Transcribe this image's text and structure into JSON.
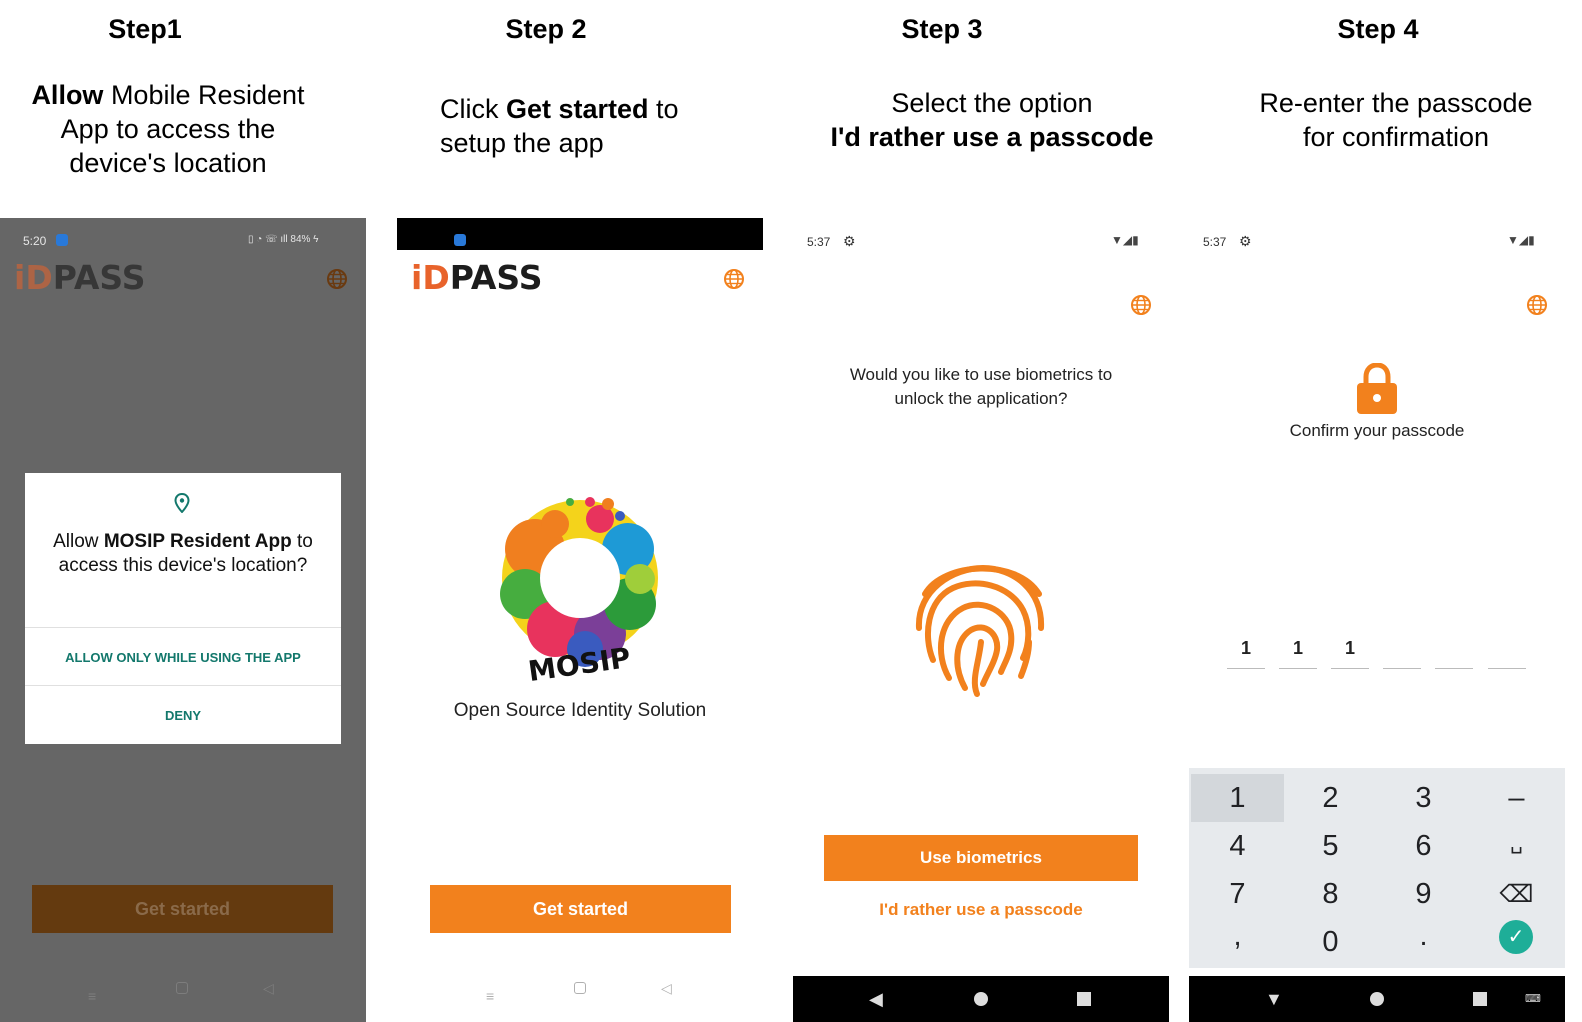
{
  "steps": [
    {
      "title": "Step1",
      "desc_bold": "Allow",
      "desc_rest": " Mobile Resident App to access the device's location"
    },
    {
      "title": "Step 2",
      "desc_pre": "Click ",
      "desc_bold": "Get started",
      "desc_post": " to setup the app"
    },
    {
      "title": "Step 3",
      "desc_line1": "Select the option",
      "desc_bold": "I'd rather use a passcode"
    },
    {
      "title": "Step 4",
      "desc_line1": "Re-enter the passcode",
      "desc_line2": "for confirmation"
    }
  ],
  "logo": {
    "i": "i",
    "d": "D",
    "rest": "PASS"
  },
  "screen1": {
    "time": "5:20",
    "battery": "84%",
    "dialog": {
      "prefix": "Allow ",
      "app_name": "MOSIP Resident App",
      "suffix": " to access this device's location?",
      "allow": "ALLOW ONLY WHILE USING THE APP",
      "deny": "DENY"
    },
    "get_started": "Get started"
  },
  "screen2": {
    "mosip": "MOSIP",
    "tagline": "Open Source Identity Solution",
    "get_started": "Get started"
  },
  "screen3": {
    "time": "5:37",
    "question_line1": "Would you like to use biometrics to",
    "question_line2": "unlock the application?",
    "use_biometrics": "Use biometrics",
    "passcode_link": "I'd rather use a passcode"
  },
  "screen4": {
    "time": "5:37",
    "confirm": "Confirm your passcode",
    "pin": [
      "1",
      "1",
      "1",
      "",
      "",
      ""
    ],
    "keys": [
      "1",
      "2",
      "3",
      "–",
      "4",
      "5",
      "6",
      "␣",
      "7",
      "8",
      "9",
      "⌫",
      ",",
      "0",
      ".",
      "✓"
    ]
  },
  "icons": {
    "globe": "globe-icon",
    "location": "location-pin-icon",
    "lock": "lock-icon",
    "fingerprint": "fingerprint-icon"
  },
  "colors": {
    "accent": "#f2811d",
    "teal": "#13786c",
    "dim_overlay": "#666666",
    "dim_button": "#643a0f"
  }
}
